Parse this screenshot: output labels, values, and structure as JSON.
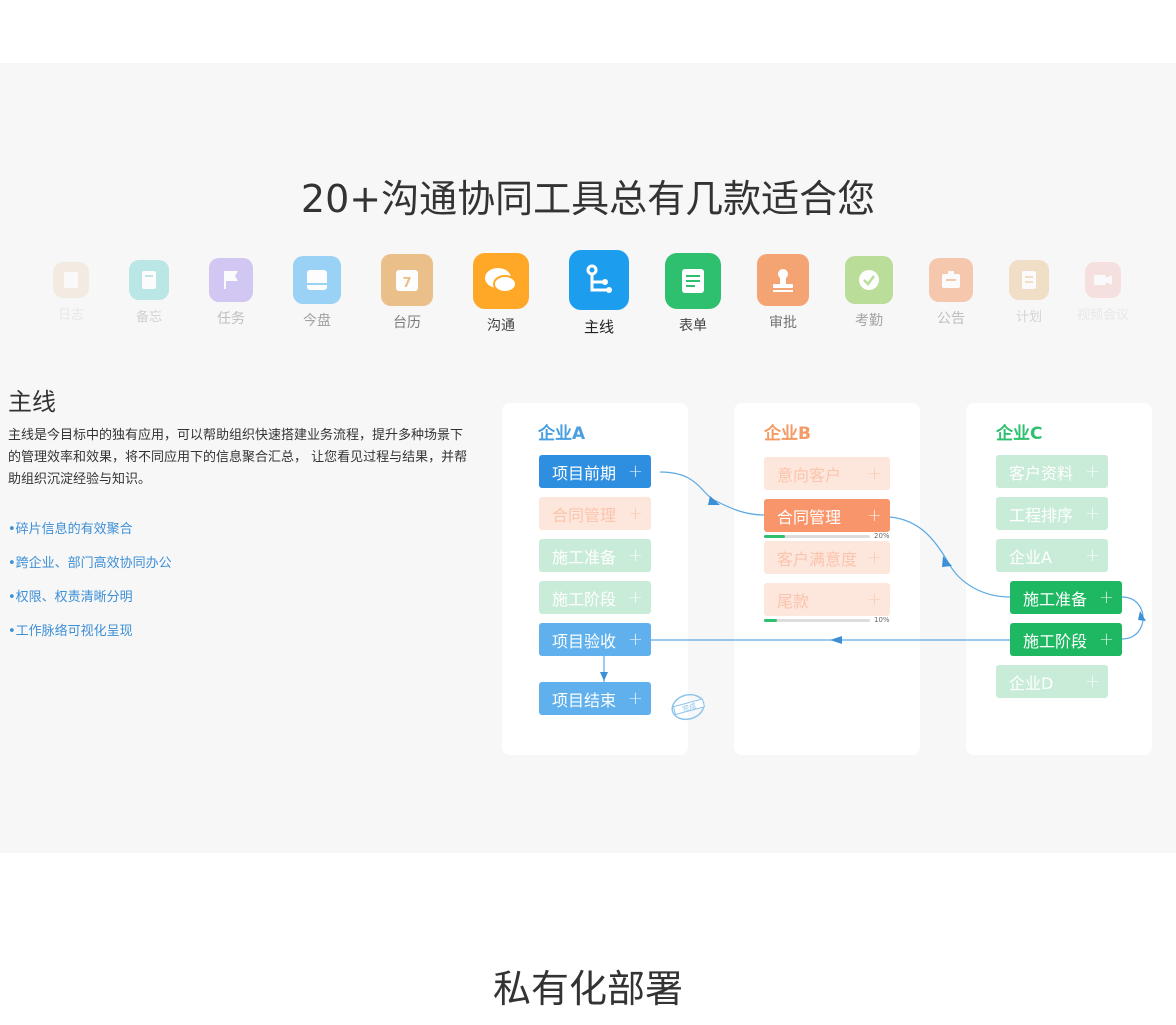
{
  "section": {
    "title": "20+沟通协同工具总有几款适合您"
  },
  "apps": [
    {
      "name": "calendar-log-icon",
      "label": "日志",
      "color": "#e8c9a8",
      "opacity": 0.25
    },
    {
      "name": "memo-icon",
      "label": "备忘",
      "color": "#7ed6d6",
      "opacity": 0.45
    },
    {
      "name": "flag-icon",
      "label": "任务",
      "color": "#b9a8f0",
      "opacity": 0.55
    },
    {
      "name": "drive-icon",
      "label": "今盘",
      "color": "#7cc6f5",
      "opacity": 0.7
    },
    {
      "name": "calendar-icon",
      "label": "台历",
      "color": "#e8b677",
      "opacity": 0.85
    },
    {
      "name": "chat-icon",
      "label": "沟通",
      "color": "#ffa726",
      "opacity": 1
    },
    {
      "name": "mainline-icon",
      "label": "主线",
      "color": "#1c9dee",
      "opacity": 1
    },
    {
      "name": "form-icon",
      "label": "表单",
      "color": "#2ec06e",
      "opacity": 1
    },
    {
      "name": "stamp-icon",
      "label": "审批",
      "color": "#f49a64",
      "opacity": 0.9
    },
    {
      "name": "check-icon",
      "label": "考勤",
      "color": "#a6d67a",
      "opacity": 0.75
    },
    {
      "name": "notice-icon",
      "label": "公告",
      "color": "#f4a97e",
      "opacity": 0.6
    },
    {
      "name": "plan-icon",
      "label": "计划",
      "color": "#e9c08e",
      "opacity": 0.45
    },
    {
      "name": "video-icon",
      "label": "视频会议",
      "color": "#f59a9a",
      "opacity": 0.25
    }
  ],
  "feature": {
    "title": "主线",
    "description": "主线是今目标中的独有应用，可以帮助组织快速搭建业务流程，提升多种场景下的管理效率和效果，将不同应用下的信息聚合汇总， 让您看见过程与结果，并帮助组织沉淀经验与知识。",
    "bullets": [
      "•碎片信息的有效聚合",
      "•跨企业、部门高效协同办公",
      "•权限、权责清晰分明",
      "•工作脉络可视化呈现"
    ]
  },
  "diagram": {
    "plus": "+",
    "cards": [
      {
        "title": "企业A",
        "color": "#4a9fe0",
        "nodes": [
          {
            "label": "项目前期",
            "state": "active"
          },
          {
            "label": "合同管理",
            "state": "faded-orange"
          },
          {
            "label": "施工准备",
            "state": "faded-green"
          },
          {
            "label": "施工阶段",
            "state": "faded-green"
          },
          {
            "label": "项目验收",
            "state": "blue"
          },
          {
            "label": "项目结束",
            "state": "blue"
          }
        ],
        "stamp": "完成"
      },
      {
        "title": "企业B",
        "color": "#f49a64",
        "nodes": [
          {
            "label": "意向客户",
            "state": "faded-orange"
          },
          {
            "label": "合同管理",
            "state": "active-orange"
          },
          {
            "label": "客户满意度",
            "state": "faded-orange"
          },
          {
            "label": "尾款",
            "state": "faded-orange"
          }
        ],
        "progress": [
          {
            "label": "20%",
            "value": 0.2
          },
          {
            "label": "10%",
            "value": 0.1
          }
        ]
      },
      {
        "title": "企业C",
        "color": "#2ec06e",
        "nodes": [
          {
            "label": "客户资料",
            "state": "faded-green"
          },
          {
            "label": "工程排序",
            "state": "faded-green"
          },
          {
            "label": "企业A",
            "state": "faded-green"
          },
          {
            "label": "施工准备",
            "state": "active-green"
          },
          {
            "label": "施工阶段",
            "state": "active-green"
          },
          {
            "label": "企业D",
            "state": "faded-green"
          }
        ]
      }
    ]
  },
  "next_section": {
    "title": "私有化部署"
  }
}
